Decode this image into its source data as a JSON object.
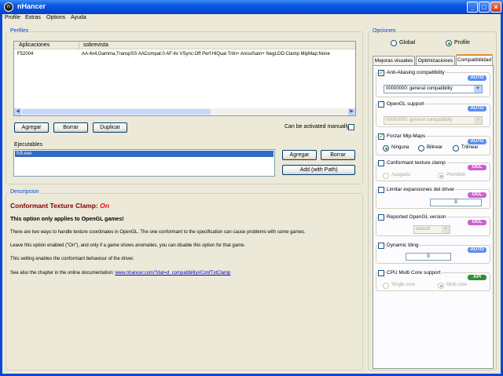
{
  "window": {
    "title": "nHancer",
    "icon_letter": "n"
  },
  "menu": [
    "Profile",
    "Extras",
    "Options",
    "Ayuda"
  ],
  "perfiles": {
    "title": "Perfiles",
    "columns": [
      "Aplicaciones",
      "sobrevista"
    ],
    "rows": [
      {
        "app": "F52004",
        "desc": "AA:4x4,Gamma,TranspSS AACompat:0 AF:4x VSync:Off Perf:HiQual Triln+ AnisoSam+ NegLOD:Clamp MipMap:None"
      }
    ],
    "buttons": {
      "add": "Agregar",
      "delete": "Borrar",
      "duplicate": "Duplicar"
    },
    "manual_label": "Can be activated manually",
    "exec_label": "Ejecutables",
    "exec_items": [
      "fs9.exe"
    ],
    "exec_add": "Agregar",
    "exec_delete": "Borrar",
    "add_with_path": "Add (with Path)"
  },
  "descripcion": {
    "title": "Descripcion",
    "heading": "Conformant Texture Clamp:",
    "heading_value": "On",
    "bold_line": "This option only applies to OpenGL games!",
    "p1": "There are two ways to handle texture coordinates in OpenGL. The one conformant to the specification can cause problems with some games.",
    "p2": "Leave this option enabled (\"On\"), and only if a game shows anomalies, you can disable this option for that game.",
    "p3": "This setting enables the conformant behaviour of the driver.",
    "p4_prefix": "See also the chapter in the online documentation:",
    "p4_link": "www.nhancer.com/?dat=d_compatibility#ConfTxtClamp"
  },
  "opciones": {
    "title": "Opciones",
    "radio_global": "Global",
    "radio_profile": "Profile",
    "tabs": [
      "Mejoras visuales",
      "Optimizaciones",
      "Compatibilidad"
    ],
    "aa": {
      "label": "Anti-Aliasing compatibility",
      "badge": "AUTO",
      "value": "00000000: general compatibility"
    },
    "ogl": {
      "label": "OpenGL support",
      "badge": "AUTO",
      "value": "00000000: general compatibility"
    },
    "mip": {
      "label": "Forzar Mip-Maps",
      "badge": "AUTO",
      "opts": [
        "Ninguna",
        "Bilinear",
        "Trilinear"
      ]
    },
    "ctc": {
      "label": "Conformant texture clamp",
      "badge": "OGL",
      "opts": [
        "Apagado",
        "Prendido"
      ]
    },
    "lim": {
      "label": "Limitar expansiones del driver",
      "badge": "OGL",
      "value": "0"
    },
    "rep": {
      "label": "Reported OpenGL version",
      "badge": "OGL",
      "value": "default"
    },
    "dyn": {
      "label": "Dynamic tiling",
      "badge": "AUTO",
      "value": "0"
    },
    "cpu": {
      "label": "CPU Multi Core support",
      "badge": "API",
      "opts": [
        "Single core",
        "Multi core"
      ]
    }
  }
}
